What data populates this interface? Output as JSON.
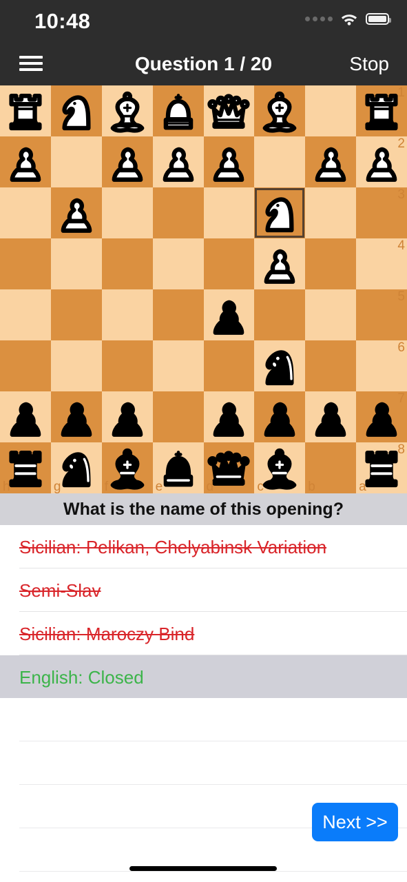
{
  "status_bar": {
    "time": "10:48",
    "cellular_icon": "cellular-dots-icon",
    "wifi_icon": "wifi-icon",
    "battery_icon": "battery-icon"
  },
  "nav_bar": {
    "menu_icon": "hamburger-menu-icon",
    "title": "Question 1 / 20",
    "stop_label": "Stop"
  },
  "board": {
    "light_square_color": "#fad3a2",
    "dark_square_color": "#db9040",
    "highlight_border_color": "#55412f",
    "coordinate_color": "#cf8336",
    "orientation": "flipped-horizontal-white-top",
    "file_labels": [
      "h",
      "g",
      "f",
      "e",
      "d",
      "c",
      "b",
      "a"
    ],
    "rank_labels": [
      "1",
      "2",
      "3",
      "4",
      "5",
      "6",
      "7",
      "8"
    ],
    "highlighted_square": "c3",
    "rows": [
      [
        "wR",
        "wN",
        "wB",
        "wK",
        "wQ",
        "wB",
        "",
        "wR"
      ],
      [
        "wP",
        "",
        "wP",
        "wP",
        "wP",
        "",
        "wP",
        "wP"
      ],
      [
        "",
        "wP",
        "",
        "",
        "",
        "wN",
        "",
        ""
      ],
      [
        "",
        "",
        "",
        "",
        "",
        "wP",
        "",
        ""
      ],
      [
        "",
        "",
        "",
        "",
        "bP",
        "",
        "",
        ""
      ],
      [
        "",
        "",
        "",
        "",
        "",
        "bN",
        "",
        ""
      ],
      [
        "bP",
        "bP",
        "bP",
        "",
        "bP",
        "bP",
        "bP",
        "bP"
      ],
      [
        "bR",
        "bN",
        "bB",
        "bK",
        "bQ",
        "bB",
        "",
        "bR"
      ]
    ]
  },
  "question": {
    "text": "What is the name of this opening?"
  },
  "answers": [
    {
      "label": "Sicilian: Pelikan, Chelyabinsk Variation",
      "state": "wrong"
    },
    {
      "label": "Semi-Slav",
      "state": "wrong"
    },
    {
      "label": "Sicilian: Maroczy Bind",
      "state": "wrong"
    },
    {
      "label": "English: Closed",
      "state": "correct"
    }
  ],
  "colors": {
    "wrong_text": "#d9252a",
    "correct_text": "#3cb44a",
    "correct_row_bg": "#d0d0d8",
    "accent_blue": "#0a7cfa",
    "navbar_bg": "#2d2d2d",
    "question_bar_bg": "#d2d2d7"
  },
  "footer": {
    "next_label": "Next >>",
    "home_indicator": "home-indicator"
  }
}
